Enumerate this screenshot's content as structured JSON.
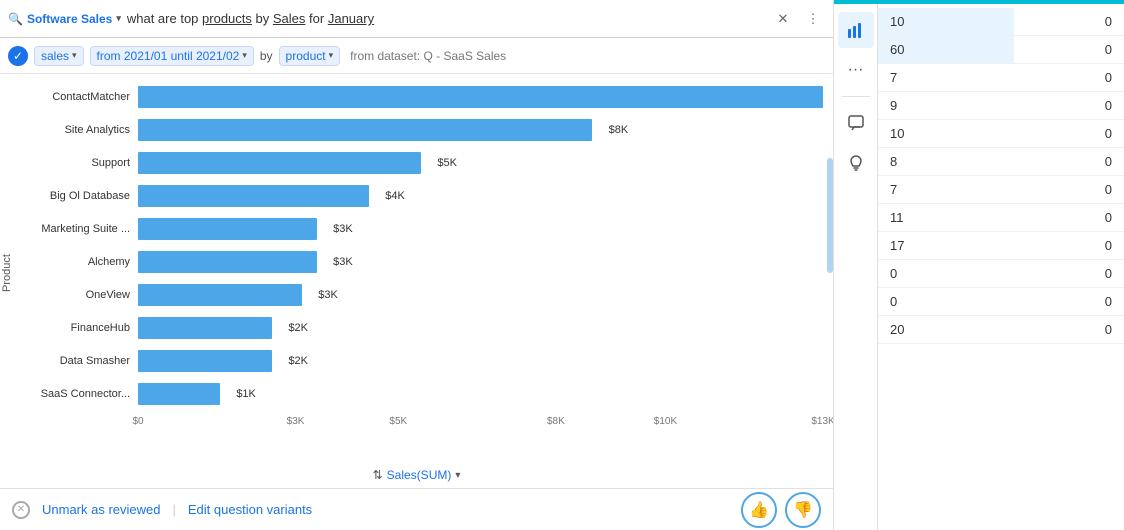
{
  "search": {
    "app_name": "Software Sales",
    "app_icon": "🔍",
    "query_prefix": "what are top",
    "query_underline1": "products",
    "query_mid": "by",
    "query_underline2": "Sales",
    "query_mid2": "for",
    "query_underline3": "January"
  },
  "filters": {
    "check_icon": "✓",
    "chip1_label": "sales",
    "chip2_label": "from 2021/01 until 2021/02",
    "by_label": "by",
    "chip3_label": "product",
    "dataset_label": "from dataset: Q - SaaS Sales"
  },
  "chart": {
    "y_axis_label": "Product",
    "sort_label": "Sales(SUM)",
    "sort_arrow": "▾",
    "bars": [
      {
        "label": "ContactMatcher",
        "value": "$12K",
        "pct": 92
      },
      {
        "label": "Site Analytics",
        "value": "$8K",
        "pct": 61
      },
      {
        "label": "Support",
        "value": "$5K",
        "pct": 38
      },
      {
        "label": "Big Ol Database",
        "value": "$4K",
        "pct": 31
      },
      {
        "label": "Marketing Suite ...",
        "value": "$3K",
        "pct": 24
      },
      {
        "label": "Alchemy",
        "value": "$3K",
        "pct": 24
      },
      {
        "label": "OneView",
        "value": "$3K",
        "pct": 22
      },
      {
        "label": "FinanceHub",
        "value": "$2K",
        "pct": 18
      },
      {
        "label": "Data Smasher",
        "value": "$2K",
        "pct": 18
      },
      {
        "label": "SaaS Connector...",
        "value": "$1K",
        "pct": 11
      }
    ],
    "x_ticks": [
      "$0",
      "$3K",
      "$5K",
      "$8K",
      "$10K",
      "$13K"
    ]
  },
  "bottom": {
    "unmark_label": "Unmark as reviewed",
    "edit_label": "Edit question variants",
    "thumbup": "👍",
    "thumbdown": "👎"
  },
  "right_panel": {
    "nav_icons": [
      "📊",
      "···",
      "💬",
      "💡"
    ],
    "table_rows": [
      {
        "col1": "10",
        "col2": "0"
      },
      {
        "col1": "60",
        "col2": "0"
      },
      {
        "col1": "7",
        "col2": "0"
      },
      {
        "col1": "9",
        "col2": "0"
      },
      {
        "col1": "10",
        "col2": "0"
      },
      {
        "col1": "8",
        "col2": "0"
      },
      {
        "col1": "7",
        "col2": "0"
      },
      {
        "col1": "11",
        "col2": "0"
      },
      {
        "col1": "17",
        "col2": "0"
      },
      {
        "col1": "0",
        "col2": "0"
      },
      {
        "col1": "0",
        "col2": "0"
      },
      {
        "col1": "20",
        "col2": "0"
      }
    ]
  }
}
